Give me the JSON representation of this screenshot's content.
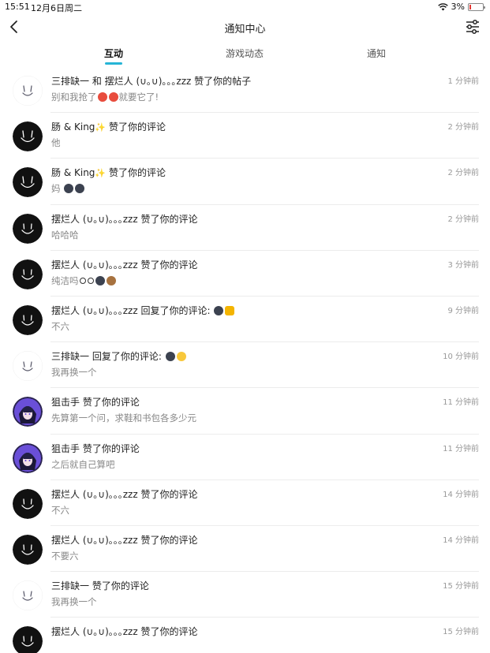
{
  "status": {
    "time": "15:51",
    "date": "12月6日周二",
    "battery": "3%"
  },
  "nav": {
    "title": "通知中心"
  },
  "tabs": [
    {
      "label": "互动",
      "active": true
    },
    {
      "label": "游戏动态",
      "active": false
    },
    {
      "label": "通知",
      "active": false
    }
  ],
  "notifications": [
    {
      "name": "三排缺一",
      "mid": " 和 ",
      "name2": "摆烂人 (∪｡∪)｡｡｡zzz",
      "action": " 赞了你的帖子",
      "content": "别和我抢了",
      "content2": "就要它了!",
      "time": "1 分钟前",
      "avatar": "white"
    },
    {
      "name": "肠 & King",
      "action": " 赞了你的评论",
      "content": "他",
      "time": "2 分钟前",
      "avatar": "black"
    },
    {
      "name": "肠 & King",
      "action": " 赞了你的评论",
      "content": "妈",
      "time": "2 分钟前",
      "avatar": "black"
    },
    {
      "name": "摆烂人 (∪｡∪)｡｡｡zzz",
      "action": " 赞了你的评论",
      "content": "哈哈哈",
      "time": "2 分钟前",
      "avatar": "black"
    },
    {
      "name": "摆烂人 (∪｡∪)｡｡｡zzz",
      "action": " 赞了你的评论",
      "content": "纯洁吗",
      "time": "3 分钟前",
      "avatar": "black"
    },
    {
      "name": "摆烂人 (∪｡∪)｡｡｡zzz",
      "action": " 回复了你的评论: ",
      "content": "不六",
      "time": "9 分钟前",
      "avatar": "black"
    },
    {
      "name": "三排缺一",
      "action": " 回复了你的评论: ",
      "content": "我再换一个",
      "time": "10 分钟前",
      "avatar": "white"
    },
    {
      "name": "狙击手",
      "action": " 赞了你的评论",
      "content": "先算第一个问，求鞋和书包各多少元",
      "time": "11 分钟前",
      "avatar": "anime"
    },
    {
      "name": "狙击手",
      "action": " 赞了你的评论",
      "content": "之后就自己算吧",
      "time": "11 分钟前",
      "avatar": "anime"
    },
    {
      "name": "摆烂人 (∪｡∪)｡｡｡zzz",
      "action": " 赞了你的评论",
      "content": "不六",
      "time": "14 分钟前",
      "avatar": "black"
    },
    {
      "name": "摆烂人 (∪｡∪)｡｡｡zzz",
      "action": " 赞了你的评论",
      "content": "不要六",
      "time": "14 分钟前",
      "avatar": "black"
    },
    {
      "name": "三排缺一",
      "action": " 赞了你的评论",
      "content": "我再换一个",
      "time": "15 分钟前",
      "avatar": "white"
    },
    {
      "name": "摆烂人 (∪｡∪)｡｡｡zzz",
      "action": " 赞了你的评论",
      "content": "",
      "time": "15 分钟前",
      "avatar": "black"
    }
  ]
}
